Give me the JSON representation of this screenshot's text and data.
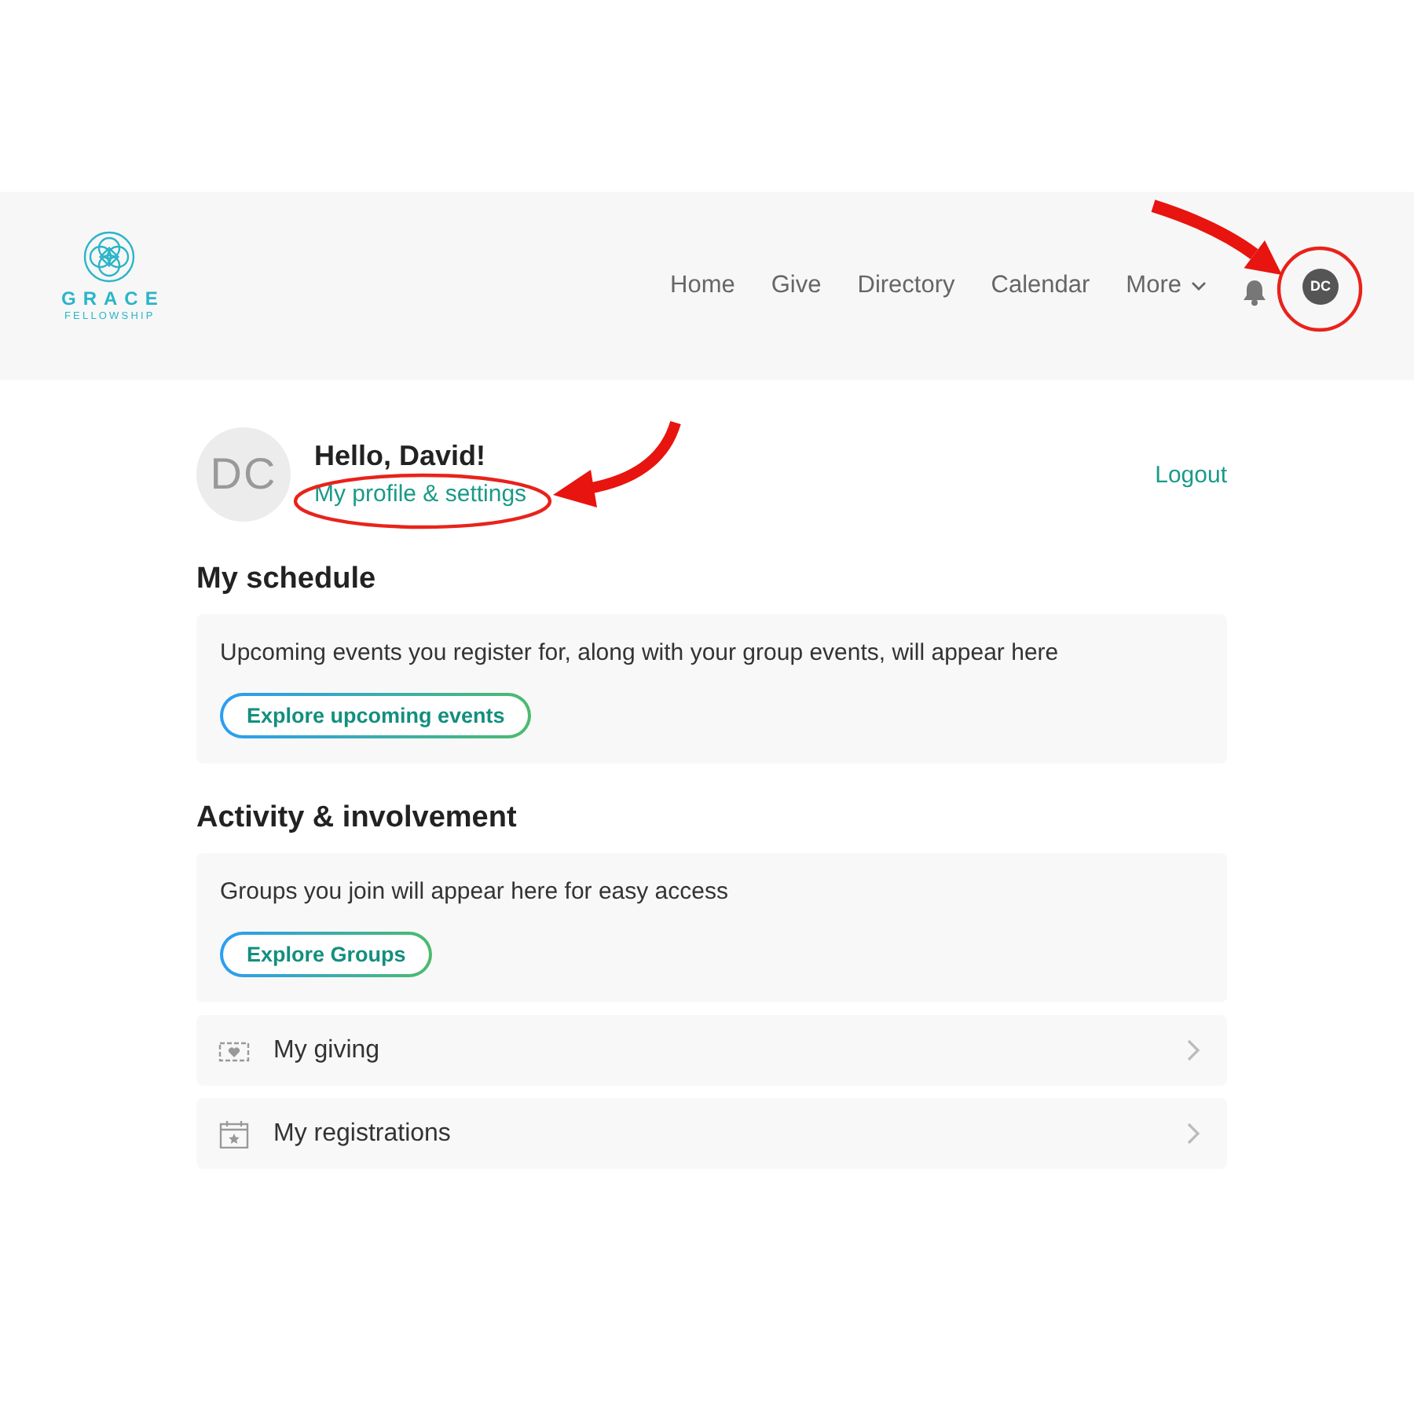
{
  "header": {
    "logo": {
      "name": "GRACE",
      "subtitle": "FELLOWSHIP"
    },
    "nav": [
      {
        "label": "Home",
        "kind": "link"
      },
      {
        "label": "Give",
        "kind": "link"
      },
      {
        "label": "Directory",
        "kind": "link"
      },
      {
        "label": "Calendar",
        "kind": "link"
      },
      {
        "label": "More",
        "kind": "dropdown"
      }
    ],
    "avatar": {
      "initials": "DC",
      "annotated": true
    }
  },
  "profile": {
    "initials": "DC",
    "greeting": "Hello, David!",
    "link": {
      "label": "My profile & settings",
      "annotated": true
    },
    "logout": "Logout"
  },
  "sections": [
    {
      "title": "My schedule",
      "message": "Upcoming events you register for, along with your group events, will appear here",
      "button": "Explore upcoming events"
    },
    {
      "title": "Activity & involvement",
      "message": "Groups you join will appear here for easy access",
      "button": "Explore Groups"
    }
  ],
  "links": [
    {
      "label": "My giving",
      "kind": "giving"
    },
    {
      "label": "My registrations",
      "kind": "registrations"
    }
  ]
}
